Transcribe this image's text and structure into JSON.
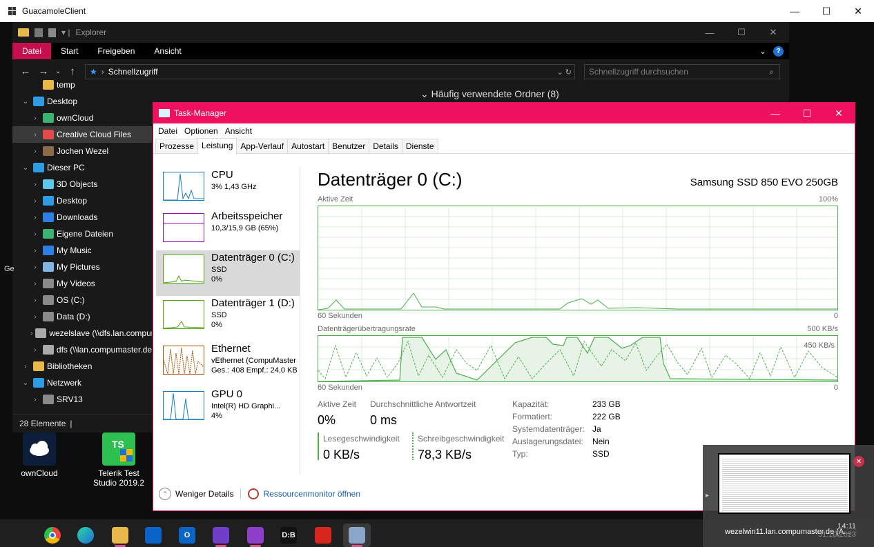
{
  "outer": {
    "title": "GuacamoleClient",
    "minimize": "—",
    "maximize": "☐",
    "close": "✕"
  },
  "explorer": {
    "title": "Explorer",
    "ribbon": [
      "Datei",
      "Start",
      "Freigeben",
      "Ansicht"
    ],
    "address": "Schnellzugriff",
    "search_placeholder": "Schnellzugriff durchsuchen",
    "frequent_folders": "Häufig verwendete Ordner (8)",
    "nav": [
      {
        "label": "temp",
        "chev": "",
        "color": "#e8b94a"
      },
      {
        "label": "Desktop",
        "chev": "⌄",
        "color": "#2f9be3"
      },
      {
        "label": "ownCloud",
        "chev": "›",
        "color": "#3cb371"
      },
      {
        "label": "Creative Cloud Files",
        "chev": "›",
        "color": "#e34b4b"
      },
      {
        "label": "Jochen Wezel",
        "chev": "›",
        "color": "#8b6b4a"
      },
      {
        "label": "Dieser PC",
        "chev": "⌄",
        "color": "#2f9be3"
      },
      {
        "label": "3D Objects",
        "chev": "›",
        "color": "#5fc8e8"
      },
      {
        "label": "Desktop",
        "chev": "›",
        "color": "#2f9be3"
      },
      {
        "label": "Downloads",
        "chev": "›",
        "color": "#2f7fe3"
      },
      {
        "label": "Eigene Dateien",
        "chev": "›",
        "color": "#3cb371"
      },
      {
        "label": "My Music",
        "chev": "›",
        "color": "#2f7fe3"
      },
      {
        "label": "My Pictures",
        "chev": "›",
        "color": "#7fb6e3"
      },
      {
        "label": "My Videos",
        "chev": "›",
        "color": "#8a8a8a"
      },
      {
        "label": "OS (C:)",
        "chev": "›",
        "color": "#8a8a8a"
      },
      {
        "label": "Data (D:)",
        "chev": "›",
        "color": "#8a8a8a"
      },
      {
        "label": "wezelslave (\\\\dfs.lan.compumaster.de",
        "chev": "›",
        "color": "#aaaaaa"
      },
      {
        "label": "dfs (\\\\lan.compumaster.de",
        "chev": "›",
        "color": "#aaaaaa"
      },
      {
        "label": "Bibliotheken",
        "chev": "›",
        "color": "#e8b94a"
      },
      {
        "label": "Netzwerk",
        "chev": "⌄",
        "color": "#2f9be3"
      },
      {
        "label": "SRV13",
        "chev": "›",
        "color": "#8a8a8a"
      }
    ],
    "status": "28 Elemente"
  },
  "desktop": {
    "icons": [
      {
        "label": "ownCloud"
      },
      {
        "label": "Telerik Test Studio 2019.2"
      }
    ],
    "side_text": "Ge"
  },
  "taskmgr": {
    "title": "Task-Manager",
    "menu": [
      "Datei",
      "Optionen",
      "Ansicht"
    ],
    "tabs": [
      "Prozesse",
      "Leistung",
      "App-Verlauf",
      "Autostart",
      "Benutzer",
      "Details",
      "Dienste"
    ],
    "active_tab": "Leistung",
    "perf": [
      {
        "name": "CPU",
        "l1": "3% 1,43 GHz",
        "l2": "",
        "l3": "",
        "color": "#117dbb"
      },
      {
        "name": "Arbeitsspeicher",
        "l1": "10,3/15,9 GB (65%)",
        "l2": "",
        "l3": "",
        "color": "#8b12ae"
      },
      {
        "name": "Datenträger 0 (C:)",
        "l1": "SSD",
        "l2": "0%",
        "l3": "",
        "color": "#4da60c"
      },
      {
        "name": "Datenträger 1 (D:)",
        "l1": "SSD",
        "l2": "0%",
        "l3": "",
        "color": "#4da60c"
      },
      {
        "name": "Ethernet",
        "l1": "vEthernet (CompuMaster",
        "l2": "Ges.: 408  Empf.: 24,0 KB",
        "l3": "",
        "color": "#a74f01"
      },
      {
        "name": "GPU 0",
        "l1": "Intel(R) HD Graphi...",
        "l2": "4%",
        "l3": "",
        "color": "#117dbb"
      }
    ],
    "heading": "Datenträger 0 (C:)",
    "model": "Samsung SSD 850 EVO 250GB",
    "graph1": {
      "label": "Aktive Zeit",
      "max": "100%",
      "x_left": "60 Sekunden",
      "x_right": "0"
    },
    "graph2": {
      "label": "Datenträgerübertragungsrate",
      "max": "500 KB/s",
      "inner": "450 KB/s",
      "x_left": "60 Sekunden",
      "x_right": "0"
    },
    "stats": {
      "active_label": "Aktive Zeit",
      "active_value": "0%",
      "resp_label": "Durchschnittliche Antwortzeit",
      "resp_value": "0 ms",
      "read_label": "Lesegeschwindigkeit",
      "read_value": "0 KB/s",
      "write_label": "Schreibgeschwindigkeit",
      "write_value": "78,3 KB/s"
    },
    "kv": [
      {
        "k": "Kapazität:",
        "v": "233 GB"
      },
      {
        "k": "Formatiert:",
        "v": "222 GB"
      },
      {
        "k": "Systemdatenträger:",
        "v": "Ja"
      },
      {
        "k": "Auslagerungsdatei:",
        "v": "Nein"
      },
      {
        "k": "Typ:",
        "v": "SSD"
      }
    ],
    "footer": {
      "less": "Weniger Details",
      "resmon": "Ressourcenmonitor öffnen"
    }
  },
  "taskbar": {
    "apps": [
      {
        "name": "windows-start",
        "glyph": "",
        "color": "#ffffff"
      },
      {
        "name": "chrome",
        "glyph": "",
        "color": "#e8453c"
      },
      {
        "name": "edge",
        "glyph": "",
        "color": "#1e9bd7"
      },
      {
        "name": "file-explorer",
        "glyph": "",
        "color": "#e8b94a"
      },
      {
        "name": "mail",
        "glyph": "",
        "color": "#0a64c8"
      },
      {
        "name": "outlook",
        "glyph": "O",
        "color": "#0a64c8"
      },
      {
        "name": "github",
        "glyph": "",
        "color": "#6e3fc6"
      },
      {
        "name": "visual-studio",
        "glyph": "",
        "color": "#8e3ec8"
      },
      {
        "name": "dib",
        "glyph": "D:B",
        "color": "#111111"
      },
      {
        "name": "acrobat",
        "glyph": "",
        "color": "#d7261e"
      },
      {
        "name": "remote",
        "glyph": "",
        "color": "#8aa6c8"
      }
    ],
    "preview_caption": "wezelwin11.lan.compumaster.de (A...",
    "time": "14:11",
    "date": "31.10.2023"
  }
}
